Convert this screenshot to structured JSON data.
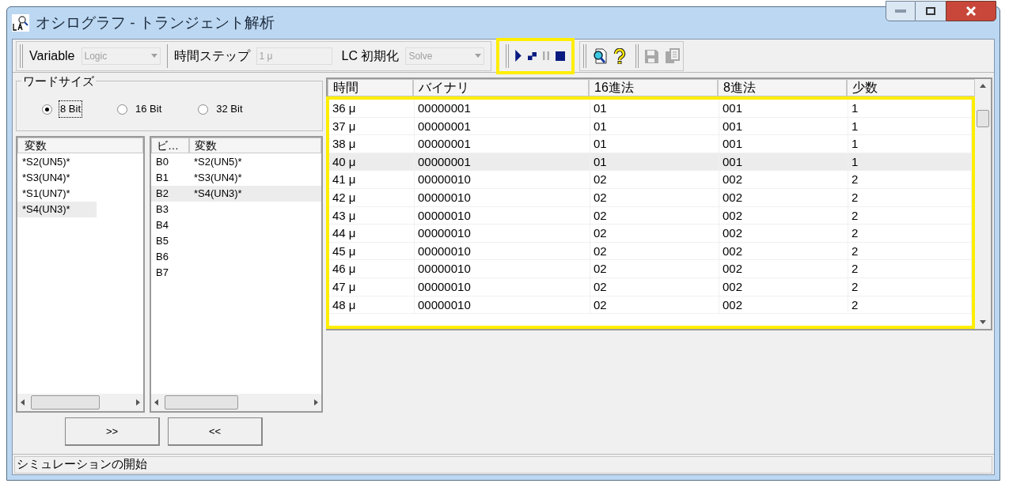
{
  "window": {
    "title": "オシログラフ - トランジェント解析"
  },
  "toolbar": {
    "variable": {
      "label": "Variable",
      "value": "Logic",
      "disabled": true
    },
    "time_step": {
      "label": "時間ステップ",
      "value": "1 μ",
      "disabled": true
    },
    "lc_init": {
      "label": "LC 初期化",
      "value": "Solve",
      "disabled": true
    },
    "run_group": {
      "highlighted": true,
      "buttons": [
        {
          "kind": "play",
          "disabled": false
        },
        {
          "kind": "step",
          "disabled": false
        },
        {
          "kind": "pause",
          "disabled": true
        },
        {
          "kind": "stop",
          "disabled": false
        }
      ]
    },
    "tools": [
      {
        "kind": "zoom"
      },
      {
        "kind": "help"
      }
    ],
    "file_tools": [
      {
        "kind": "save",
        "disabled": true
      },
      {
        "kind": "copy",
        "disabled": true
      }
    ]
  },
  "word_size": {
    "legend": "ワードサイズ",
    "options": [
      {
        "label": "8 Bit",
        "selected": true
      },
      {
        "label": "16 Bit",
        "selected": false
      },
      {
        "label": "32 Bit",
        "selected": false
      }
    ]
  },
  "variables_list": {
    "column": "変数",
    "items": [
      {
        "text": "*S2(UN5)*",
        "selected": false
      },
      {
        "text": "*S3(UN4)*",
        "selected": false
      },
      {
        "text": "*S1(UN7)*",
        "selected": false
      },
      {
        "text": "*S4(UN3)*",
        "selected": true
      }
    ]
  },
  "bits_list": {
    "columns": [
      "ビ…",
      "変数"
    ],
    "rows": [
      {
        "bit": "B0",
        "variable": "*S2(UN5)*",
        "selected": false
      },
      {
        "bit": "B1",
        "variable": "*S3(UN4)*",
        "selected": false
      },
      {
        "bit": "B2",
        "variable": "*S4(UN3)*",
        "selected": true
      },
      {
        "bit": "B3",
        "selected": false
      },
      {
        "bit": "B4",
        "selected": false
      },
      {
        "bit": "B5",
        "selected": false
      },
      {
        "bit": "B6",
        "selected": false
      },
      {
        "bit": "B7",
        "selected": false
      }
    ]
  },
  "move_buttons": [
    ">>",
    "<<"
  ],
  "table": {
    "highlighted": true,
    "columns": [
      "時間",
      "バイナリ",
      "16進法",
      "8進法",
      "少数"
    ],
    "rows": [
      {
        "cells": [
          "36 μ",
          "00000001",
          "01",
          "001",
          "1"
        ],
        "selected": false
      },
      {
        "cells": [
          "37 μ",
          "00000001",
          "01",
          "001",
          "1"
        ],
        "selected": false
      },
      {
        "cells": [
          "38 μ",
          "00000001",
          "01",
          "001",
          "1"
        ],
        "selected": false
      },
      {
        "cells": [
          "40 μ",
          "00000001",
          "01",
          "001",
          "1"
        ],
        "selected": true
      },
      {
        "cells": [
          "41 μ",
          "00000010",
          "02",
          "002",
          "2"
        ],
        "selected": false
      },
      {
        "cells": [
          "42 μ",
          "00000010",
          "02",
          "002",
          "2"
        ],
        "selected": false
      },
      {
        "cells": [
          "43 μ",
          "00000010",
          "02",
          "002",
          "2"
        ],
        "selected": false
      },
      {
        "cells": [
          "44 μ",
          "00000010",
          "02",
          "002",
          "2"
        ],
        "selected": false
      },
      {
        "cells": [
          "45 μ",
          "00000010",
          "02",
          "002",
          "2"
        ],
        "selected": false
      },
      {
        "cells": [
          "46 μ",
          "00000010",
          "02",
          "002",
          "2"
        ],
        "selected": false
      },
      {
        "cells": [
          "47 μ",
          "00000010",
          "02",
          "002",
          "2"
        ],
        "selected": false
      },
      {
        "cells": [
          "48 μ",
          "00000010",
          "02",
          "002",
          "2"
        ],
        "selected": false
      }
    ]
  },
  "status_bar": {
    "text": "シミュレーションの開始"
  }
}
